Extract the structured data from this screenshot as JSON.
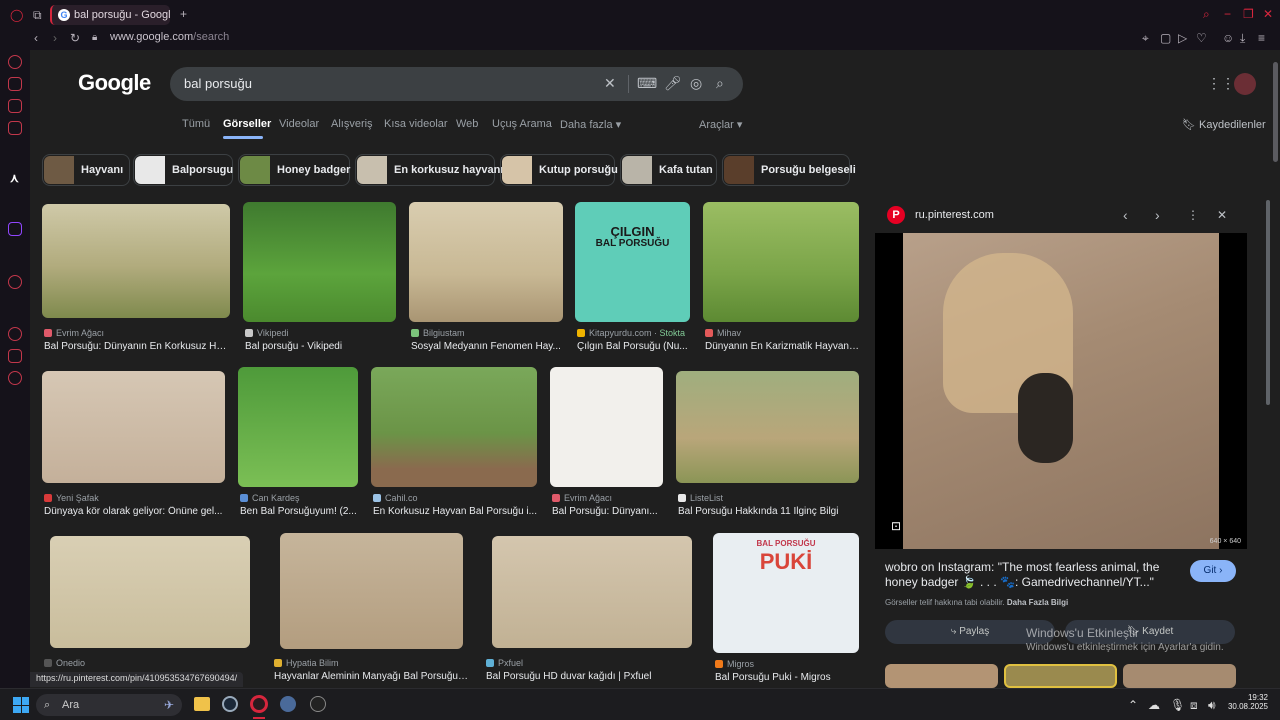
{
  "browser": {
    "tab_title": "bal porsuğu - Google'da A",
    "url_host": "www.google.com",
    "url_path": "/search"
  },
  "google": {
    "logo": "Google",
    "query": "bal porsuğu",
    "tabs": [
      "Tümü",
      "Görseller",
      "Videolar",
      "Alışveriş",
      "Kısa videolar",
      "Web",
      "Uçuş Arama",
      "Daha fazla ▾"
    ],
    "tools": "Araçlar ▾",
    "saved": "Kaydedilenler",
    "chips": [
      "Hayvanı",
      "Balporsugu",
      "Honey badger",
      "En korkusuz hayvanı",
      "Kutup porsuğu",
      "Kafa tutan",
      "Porsuğu belgeseli"
    ]
  },
  "results": [
    {
      "source": "Evrim Ağacı",
      "title": "Bal Porsuğu: Dünyanın En Korkusuz Ha..."
    },
    {
      "source": "Vikipedi",
      "title": "Bal porsuğu - Vikipedi"
    },
    {
      "source": "Bilgiustam",
      "title": "Sosyal Medyanın Fenomen Hay..."
    },
    {
      "source": "Kitapyurdu.com",
      "stock": "Stokta",
      "title": "Çılgın Bal Porsuğu (Nu..."
    },
    {
      "source": "Mihav",
      "title": "Dünyanın En Karizmatik Hayvanl..."
    },
    {
      "source": "Yeni Şafak",
      "title": "Dünyaya kör olarak geliyor: Önüne gel..."
    },
    {
      "source": "Can Kardeş",
      "title": "Ben Bal Porsuğuyum! (2..."
    },
    {
      "source": "Cahil.co",
      "title": "En Korkusuz Hayvan Bal Porsuğu i..."
    },
    {
      "source": "Evrim Ağacı",
      "title": "Bal Porsuğu: Dünyanı..."
    },
    {
      "source": "ListeList",
      "title": "Bal Porsuğu Hakkında 11 İlginç Bilgi"
    },
    {
      "source": "Onedio",
      "title": ""
    },
    {
      "source": "Hypatia Bilim",
      "title": "Hayvanlar Aleminin Manyağı Bal Porsuğu -..."
    },
    {
      "source": "Pxfuel",
      "title": "Bal Porsuğu HD duvar kağıdı | Pxfuel"
    },
    {
      "source": "Migros",
      "title": "Bal Porsuğu Puki - Migros"
    }
  ],
  "book_text": {
    "cilgin": "ÇILGIN",
    "bal_porsugu": "BAL PORSUĞU",
    "puki_top": "BAL PORSUĞU",
    "puki": "PUKİ"
  },
  "preview": {
    "site": "ru.pinterest.com",
    "size": "640 × 640",
    "title": "wobro on Instagram: \"The most fearless animal, the honey badger 🍃 . . . 🐾: Gamedrivechannel/YT...\"",
    "go": "Git",
    "copyright": "Görseller telif hakkına tabi olabilir.",
    "more_info": "Daha Fazla Bilgi",
    "share": "Paylaş",
    "save": "Kaydet"
  },
  "watermark": {
    "line1": "Windows'u Etkinleştir",
    "line2": "Windows'u etkinleştirmek için Ayarlar'a gidin."
  },
  "status_url": "https://ru.pinterest.com/pin/410953534767690494/",
  "taskbar": {
    "search": "Ara",
    "time": "19:32",
    "date": "30.08.2025"
  },
  "colors": {
    "accent": "#8ab4f8",
    "opera": "#d7263d",
    "go_button": "#8ab4f8"
  }
}
